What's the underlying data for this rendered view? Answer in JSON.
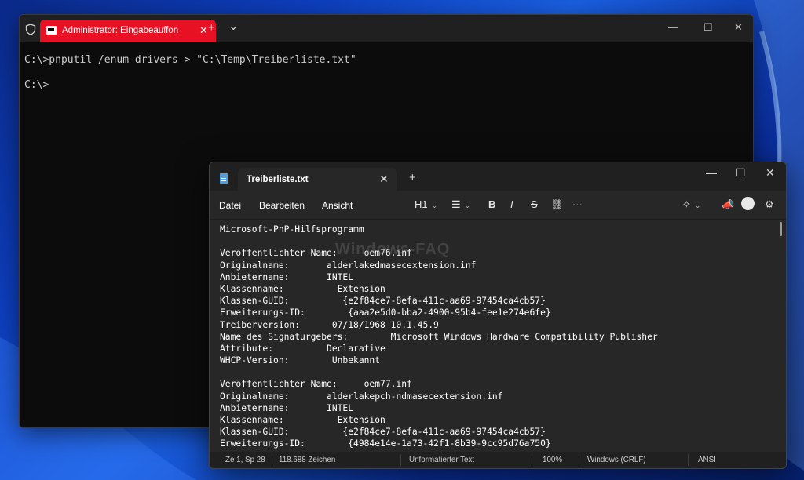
{
  "terminal": {
    "tab_title": "Administrator: Eingabeauffon",
    "new_tab": "+",
    "dropdown": "⌄",
    "lines": [
      "C:\\>pnputil /enum-drivers > \"C:\\Temp\\Treiberliste.txt\"",
      "",
      "C:\\>"
    ]
  },
  "notepad": {
    "tab_title": "Treiberliste.txt",
    "menu": {
      "file": "Datei",
      "edit": "Bearbeiten",
      "view": "Ansicht"
    },
    "format": {
      "heading": "H1",
      "bold": "B",
      "italic": "I",
      "strike": "S",
      "more": "···"
    },
    "content": [
      "Microsoft-PnP-Hilfsprogramm",
      "",
      "Veröffentlichter Name:     oem76.inf",
      "Originalname:       alderlakedmasecextension.inf",
      "Anbietername:       INTEL",
      "Klassenname:          Extension",
      "Klassen-GUID:          {e2f84ce7-8efa-411c-aa69-97454ca4cb57}",
      "Erweiterungs-ID:        {aaa2e5d0-bba2-4900-95b4-fee1e274e6fe}",
      "Treiberversion:      07/18/1968 10.1.45.9",
      "Name des Signaturgebers:        Microsoft Windows Hardware Compatibility Publisher",
      "Attribute:          Declarative",
      "WHCP-Version:        Unbekannt",
      "",
      "Veröffentlichter Name:     oem77.inf",
      "Originalname:       alderlakepch-ndmasecextension.inf",
      "Anbietername:       INTEL",
      "Klassenname:          Extension",
      "Klassen-GUID:          {e2f84ce7-8efa-411c-aa69-97454ca4cb57}",
      "Erweiterungs-ID:        {4984e14e-1a73-42f1-8b39-9cc95d76a750}"
    ],
    "watermark": "Windows-FAQ",
    "status": {
      "position": "Ze 1, Sp 28",
      "chars": "118.688 Zeichen",
      "format": "Unformatierter Text",
      "zoom": "100%",
      "line_ending": "Windows (CRLF)",
      "encoding": "ANSI"
    }
  },
  "colors": {
    "terminal_tab": "#e81123",
    "wallpaper": "#0d3fbf"
  }
}
